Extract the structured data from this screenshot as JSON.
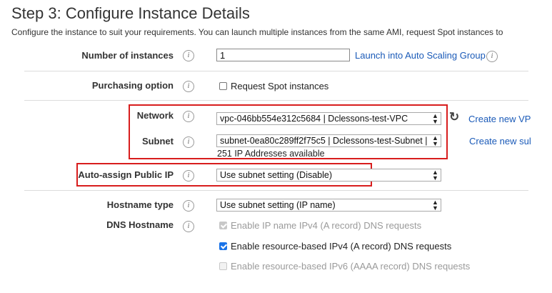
{
  "page": {
    "title": "Step 3: Configure Instance Details",
    "subtitle": "Configure the instance to suit your requirements. You can launch multiple instances from the same AMI, request Spot instances to"
  },
  "rows": {
    "instances": {
      "label": "Number of instances",
      "value": "1",
      "link": "Launch into Auto Scaling Group"
    },
    "purchasing": {
      "label": "Purchasing option",
      "checkbox_label": "Request Spot instances",
      "checked": false
    },
    "network": {
      "label": "Network",
      "selected": "vpc-046bb554e312c5684 | Dclessons-test-VPC",
      "link": "Create new VP"
    },
    "subnet": {
      "label": "Subnet",
      "selected": "subnet-0ea80c289ff2f75c5 | Dclessons-test-Subnet |",
      "note": "251 IP Addresses available",
      "link": "Create new sul"
    },
    "public_ip": {
      "label": "Auto-assign Public IP",
      "selected": "Use subnet setting (Disable)"
    },
    "hostname_type": {
      "label": "Hostname type",
      "selected": "Use subnet setting (IP name)"
    },
    "dns_hostname": {
      "label": "DNS Hostname",
      "options": [
        {
          "label": "Enable IP name IPv4 (A record) DNS requests",
          "checked": true,
          "disabled": true
        },
        {
          "label": "Enable resource-based IPv4 (A record) DNS requests",
          "checked": true,
          "disabled": false
        },
        {
          "label": "Enable resource-based IPv6 (AAAA record) DNS requests",
          "checked": false,
          "disabled": true
        }
      ]
    }
  },
  "icons": {
    "info": "info-icon",
    "refresh": "refresh-icon",
    "select_arrows": "select-arrows-icon"
  },
  "colors": {
    "link": "#1a5ab8",
    "highlight_box": "#d81d1d",
    "checkbox_checked": "#1a73e8"
  }
}
